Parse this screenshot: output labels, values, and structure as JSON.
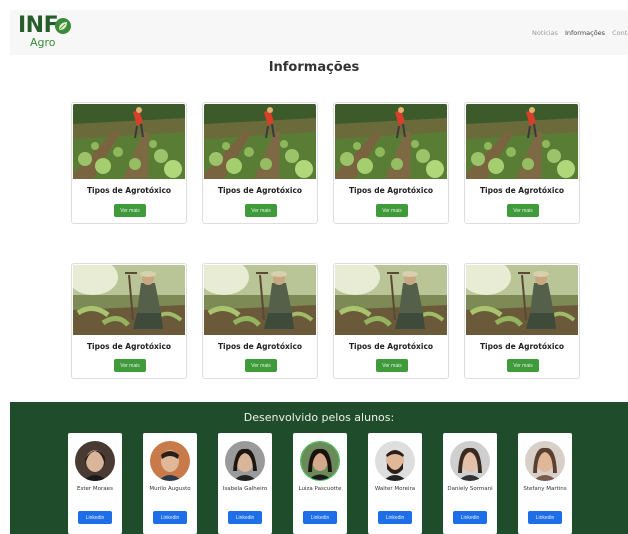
{
  "brand": {
    "name_main": "INF",
    "name_sub": "Agro"
  },
  "nav": {
    "items": [
      "Notícias",
      "Informações",
      "Contato"
    ],
    "active_index": 1
  },
  "page": {
    "title": "Informações"
  },
  "cards": [
    {
      "title": "Tipos de Agrotóxico",
      "button": "Ver mais",
      "image": "field-worker-photo"
    },
    {
      "title": "Tipos de Agrotóxico",
      "button": "Ver mais",
      "image": "field-worker-photo"
    },
    {
      "title": "Tipos de Agrotóxico",
      "button": "Ver mais",
      "image": "field-worker-photo"
    },
    {
      "title": "Tipos de Agrotóxico",
      "button": "Ver mais",
      "image": "field-worker-photo"
    },
    {
      "title": "Tipos de Agrotóxico",
      "button": "Ver mais",
      "image": "farmer-kneeling-photo"
    },
    {
      "title": "Tipos de Agrotóxico",
      "button": "Ver mais",
      "image": "farmer-kneeling-photo"
    },
    {
      "title": "Tipos de Agrotóxico",
      "button": "Ver mais",
      "image": "farmer-kneeling-photo"
    },
    {
      "title": "Tipos de Agrotóxico",
      "button": "Ver mais",
      "image": "farmer-kneeling-photo"
    }
  ],
  "footer": {
    "title": "Desenvolvido pelos alunos:",
    "developers": [
      {
        "name": "Ester Moraes",
        "button": "Linkedin"
      },
      {
        "name": "Murilo Augusto",
        "button": "Linkedin"
      },
      {
        "name": "Isabela Galheiro",
        "button": "Linkedin"
      },
      {
        "name": "Luiza Pascuotte",
        "button": "Linkedin"
      },
      {
        "name": "Walter Moreira",
        "button": "Linkedin"
      },
      {
        "name": "Daniely Sormani",
        "button": "Linkedin"
      },
      {
        "name": "Stefany Martins",
        "button": "Linkedin"
      }
    ]
  },
  "colors": {
    "brand_green": "#255e2a",
    "button_green": "#3f9a3b",
    "footer_green": "#1f4d2b",
    "linkedin_blue": "#1e6ee8"
  }
}
